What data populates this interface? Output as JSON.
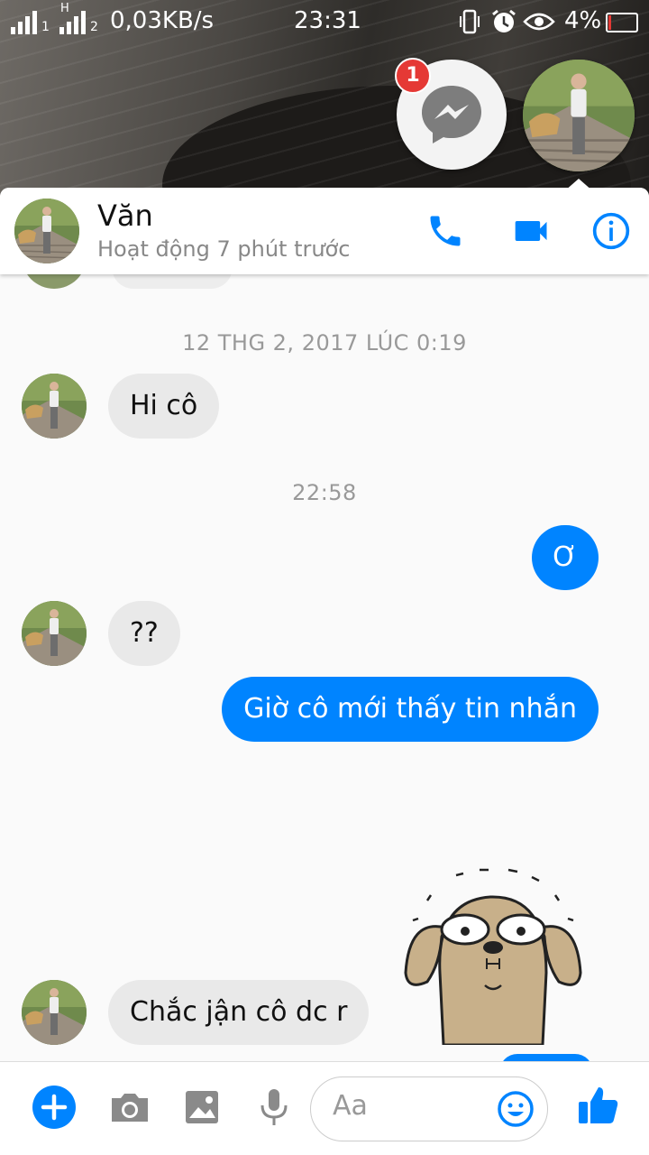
{
  "status_bar": {
    "sim1_label": "1",
    "sim2_label": "2",
    "sim2_type": "H",
    "network_speed": "0,03KB/s",
    "time": "23:31",
    "battery": "4%",
    "icons": [
      "vibrate-icon",
      "alarm-icon",
      "eye-icon",
      "battery-icon"
    ]
  },
  "chat_head": {
    "badge_count": "1",
    "icon": "messenger-icon"
  },
  "header": {
    "contact_name": "Văn",
    "status": "Hoạt động 7 phút trước",
    "actions": [
      "phone-icon",
      "video-call-icon",
      "info-icon"
    ],
    "accent_color": "#0084ff"
  },
  "messages": {
    "timestamp_1": "12 THG 2, 2017 LÚC 0:19",
    "msg_1": "Hi cô",
    "timestamp_2": "22:58",
    "msg_2": "Ơ",
    "msg_3": "??",
    "msg_4": "Giờ cô mới thấy tin nhắn",
    "msg_5": "Chắc jận cô dc r"
  },
  "composer": {
    "placeholder": "Aa",
    "icons": [
      "plus-icon",
      "camera-icon",
      "image-icon",
      "microphone-icon",
      "emoji-icon",
      "thumbs-up-icon"
    ]
  }
}
